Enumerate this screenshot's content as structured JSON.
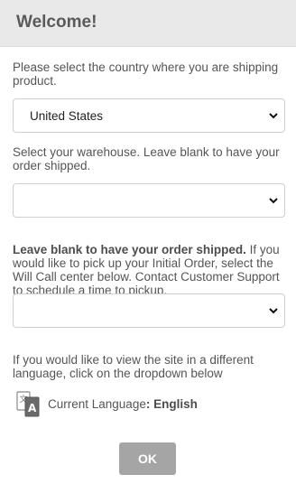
{
  "dialog": {
    "title": "Welcome!"
  },
  "country": {
    "prompt": "Please select the country where you are shipping product.",
    "selected": "United States"
  },
  "warehouse": {
    "prompt": "Select your warehouse. Leave blank to have your order shipped.",
    "selected": ""
  },
  "will_call": {
    "prompt_bold": "Leave blank to have your order shipped.",
    "prompt": "If you would like to pick up your Initial Order, select the Will Call center below. Contact Customer Support to schedule a time to pickup.",
    "selected": ""
  },
  "language": {
    "prompt": "If you would like to view the site in a different language, click on the dropdown below",
    "label": "Current Language",
    "separator": ":",
    "value": "English",
    "icon": "translate-icon"
  },
  "actions": {
    "ok_label": "OK"
  }
}
